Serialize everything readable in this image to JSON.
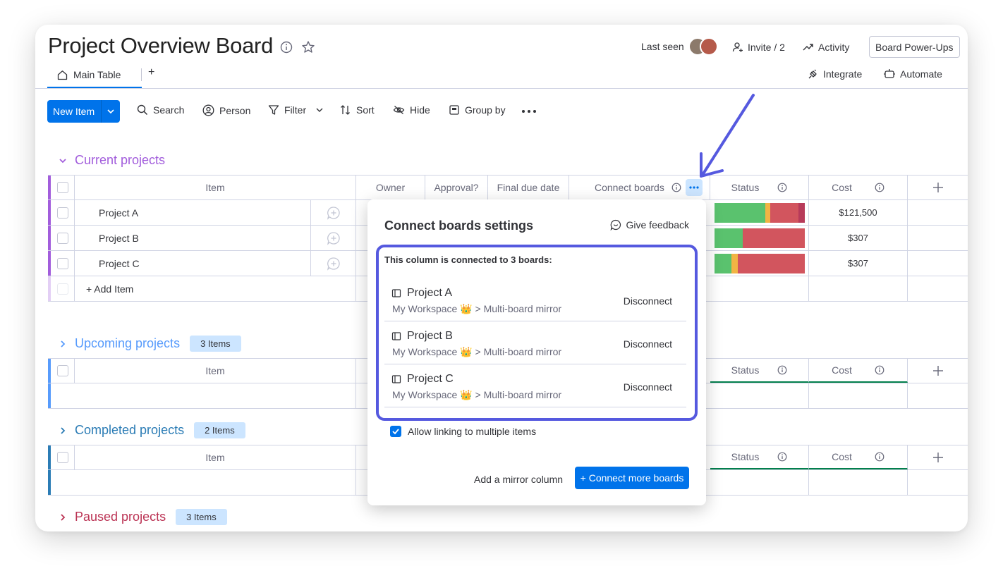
{
  "header": {
    "title": "Project Overview Board",
    "last_seen": "Last seen",
    "invite": "Invite / 2",
    "activity": "Activity",
    "power_ups": "Board Power-Ups",
    "integrate": "Integrate",
    "automate": "Automate"
  },
  "tabs": {
    "main": "Main Table",
    "add": "+"
  },
  "toolbar": {
    "new_item": "New Item",
    "search": "Search",
    "person": "Person",
    "filter": "Filter",
    "sort": "Sort",
    "hide": "Hide",
    "group_by": "Group by"
  },
  "columns": {
    "item": "Item",
    "owner": "Owner",
    "approval": "Approval?",
    "final_due": "Final due date",
    "connect": "Connect boards",
    "status": "Status",
    "cost": "Cost"
  },
  "groups": [
    {
      "title": "Current projects",
      "color": "#a25ddc",
      "rows": [
        {
          "name": "Project A",
          "cost": "$121,500",
          "status": [
            [
              "#5ac26e",
              0.56
            ],
            [
              "#f2b444",
              0.06
            ],
            [
              "#d2555e",
              0.31
            ],
            [
              "#b73b5a",
              0.07
            ]
          ]
        },
        {
          "name": "Project B",
          "cost": "$307",
          "status": [
            [
              "#5ac26e",
              0.31
            ],
            [
              "#d2555e",
              0.69
            ]
          ]
        },
        {
          "name": "Project C",
          "cost": "$307",
          "status": [
            [
              "#5ac26e",
              0.19
            ],
            [
              "#f2b444",
              0.07
            ],
            [
              "#d2555e",
              0.74
            ]
          ]
        }
      ],
      "add_item": "+ Add Item"
    },
    {
      "title": "Upcoming projects",
      "color": "#579bfc",
      "count": "3 Items"
    },
    {
      "title": "Completed projects",
      "color": "#2b7cb5",
      "count": "2 Items"
    },
    {
      "title": "Paused projects",
      "color": "#bb3354",
      "count": "3 Items"
    }
  ],
  "popup": {
    "title": "Connect boards settings",
    "feedback": "Give feedback",
    "connected_text": "This column is connected to 3 boards:",
    "boards": [
      {
        "name": "Project A",
        "path": "My Workspace 👑 > Multi-board mirror",
        "action": "Disconnect"
      },
      {
        "name": "Project B",
        "path": "My Workspace 👑 > Multi-board mirror",
        "action": "Disconnect"
      },
      {
        "name": "Project C",
        "path": "My Workspace 👑 > Multi-board mirror",
        "action": "Disconnect"
      }
    ],
    "allow_linking": "Allow linking to multiple items",
    "allow_checked": true,
    "mirror": "Add a mirror column",
    "connect_more": "+ Connect more boards"
  },
  "colors": {
    "accent": "#0073ea",
    "highlight": "#5559df"
  }
}
